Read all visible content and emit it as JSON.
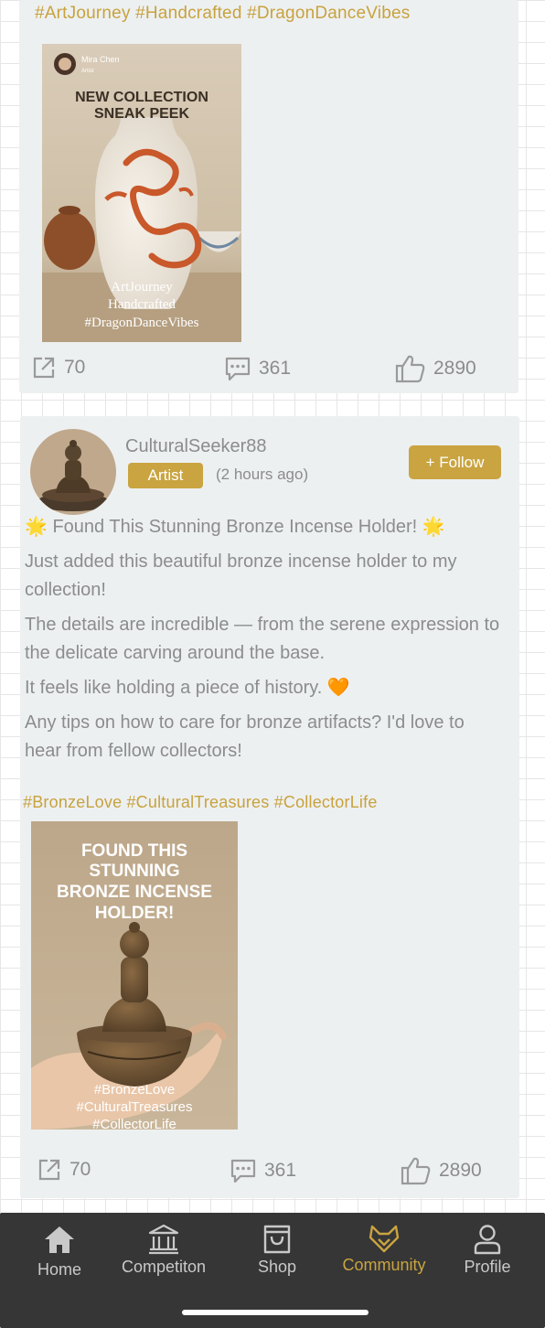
{
  "posts": [
    {
      "hashtags": "#ArtJourney #Handcrafted #DragonDanceVibes",
      "image": {
        "author_name": "Mira Chen",
        "author_role": "Artist",
        "headline_line1": "NEW COLLECTION",
        "headline_line2": "SNEAK PEEK",
        "caption_line1": "ArtJourney",
        "caption_line2": "Handcrafted",
        "caption_line3": "#DragonDanceVibes"
      },
      "stats": {
        "shares": "70",
        "comments": "361",
        "likes": "2890"
      }
    },
    {
      "username": "CulturalSeeker88",
      "role": "Artist",
      "time": "(2 hours ago)",
      "follow_label": "+ Follow",
      "title": "🌟 Found This Stunning Bronze Incense Holder! 🌟",
      "paragraphs": [
        "Just added this beautiful bronze incense holder to my collection!",
        "The details are incredible — from the serene expression to the delicate carving around the base.",
        "It feels like holding a piece of history. 🧡",
        "Any tips on how to care for bronze artifacts? I'd love to hear from fellow collectors!"
      ],
      "hashtags": "#BronzeLove #CulturalTreasures #CollectorLife",
      "image": {
        "headline_line1": "FOUND THIS",
        "headline_line2": "STUNNING",
        "headline_line3": "BRONZE INCENSE",
        "headline_line4": "HOLDER!",
        "caption_line1": "#BronzeLove",
        "caption_line2": "#CulturalTreasures",
        "caption_line3": "#CollectorLife"
      },
      "stats": {
        "shares": "70",
        "comments": "361",
        "likes": "2890"
      }
    }
  ],
  "nav": {
    "items": [
      {
        "label": "Home",
        "icon": "home-icon"
      },
      {
        "label": "Competiton",
        "icon": "museum-icon"
      },
      {
        "label": "Shop",
        "icon": "shopping-bag-icon"
      },
      {
        "label": "Community",
        "icon": "fox-icon"
      },
      {
        "label": "Profile",
        "icon": "person-icon"
      }
    ],
    "active": "Community"
  },
  "colors": {
    "accent": "#c9a440",
    "card_bg": "#edf0f1",
    "nav_bg": "#363636",
    "text_muted": "#8c8c8c"
  }
}
